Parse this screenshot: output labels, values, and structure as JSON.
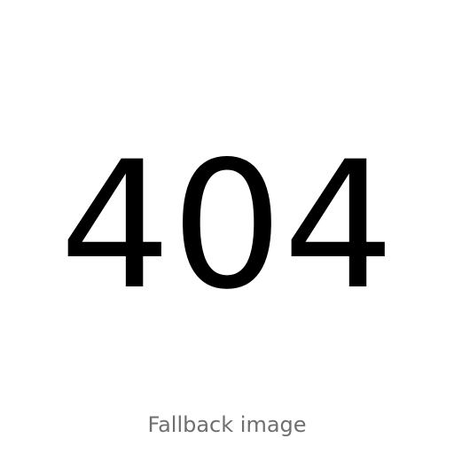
{
  "page": {
    "error_code": "404",
    "caption": "Fallback image"
  },
  "colors": {
    "background": "#ffffff",
    "error_code": "#000000",
    "caption": "#6f6f6f"
  }
}
